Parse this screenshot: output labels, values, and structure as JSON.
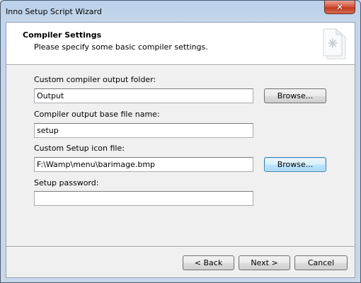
{
  "window": {
    "title": "Inno Setup Script Wizard",
    "close_glyph": "✕"
  },
  "header": {
    "title": "Compiler Settings",
    "subtitle": "Please specify some basic compiler settings.",
    "logo_icon": "wizard-page-icon"
  },
  "fields": [
    {
      "label": "Custom compiler output folder:",
      "value": "Output",
      "browse_label": "Browse..."
    },
    {
      "label": "Compiler output base file name:",
      "value": "setup"
    },
    {
      "label": "Custom Setup icon file:",
      "value": "F:\\Wamp\\menu\\barimage.bmp",
      "browse_label": "Browse..."
    },
    {
      "label": "Setup password:",
      "value": ""
    }
  ],
  "buttons": {
    "back": "< Back",
    "next": "Next >",
    "cancel": "Cancel"
  },
  "colors": {
    "close_button": "#c23b22",
    "focus_border": "#3c7fb1"
  }
}
